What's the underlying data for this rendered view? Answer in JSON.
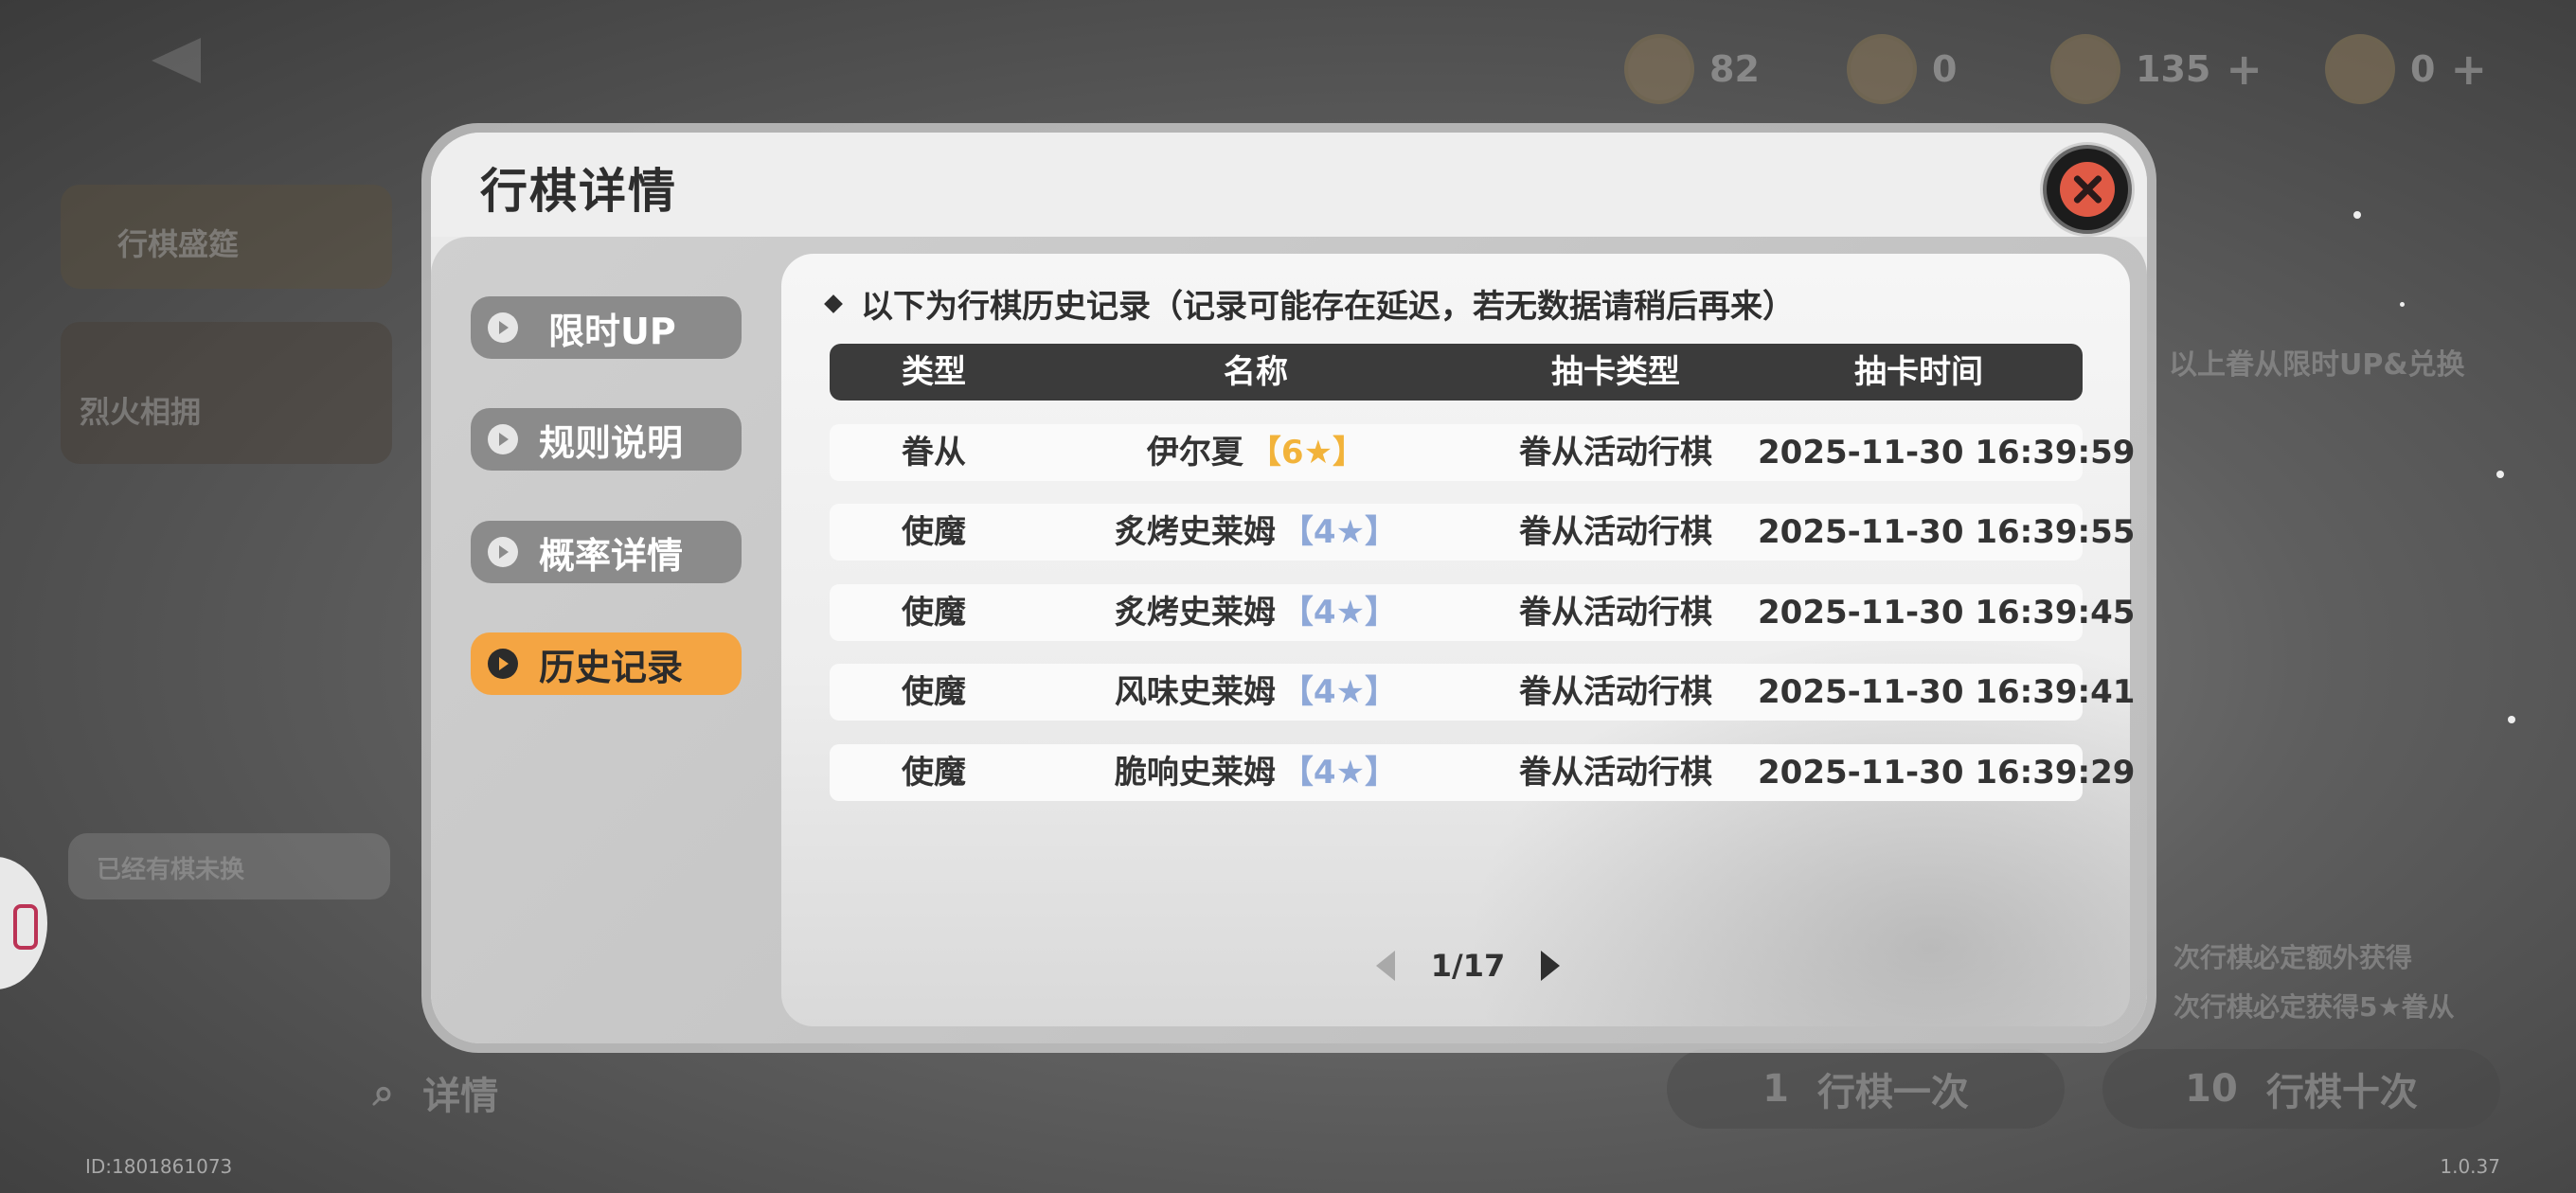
{
  "background": {
    "resources": [
      {
        "icon": "coin-icon",
        "value": "82",
        "has_plus": false
      },
      {
        "icon": "character-token-icon",
        "value": "0",
        "has_plus": false
      },
      {
        "icon": "gem-icon",
        "value": "135",
        "has_plus": true
      },
      {
        "icon": "ticket-icon",
        "value": "0",
        "has_plus": true
      }
    ],
    "left_labels": [
      "行棋盛筵",
      "烈火相拥"
    ],
    "left_sub_label": "已经有棋未换",
    "right_label": "以上眷从限时UP&兑换",
    "right_hint_1": "次行棋必定额外获得",
    "right_hint_2": "次行棋必定获得5★眷从",
    "detail_label": "详情",
    "draw_one": {
      "count": "1",
      "label": "行棋一次"
    },
    "draw_ten": {
      "count": "10",
      "label": "行棋十次"
    },
    "plus_symbol": "+",
    "user_id": "ID:1801861073",
    "version": "1.0.37"
  },
  "modal": {
    "title": "行棋详情",
    "tabs": [
      {
        "label": "限时UP",
        "active": false
      },
      {
        "label": "规则说明",
        "active": false
      },
      {
        "label": "概率详情",
        "active": false
      },
      {
        "label": "历史记录",
        "active": true
      }
    ],
    "notice": "以下为行棋历史记录（记录可能存在延迟，若无数据请稍后再来）",
    "table": {
      "headers": {
        "type": "类型",
        "name": "名称",
        "draw_type": "抽卡类型",
        "draw_time": "抽卡时间"
      },
      "rows": [
        {
          "type": "眷从",
          "name": "伊尔夏",
          "rarity": "【6★】",
          "rarity_color": "#f2b33a",
          "draw_type": "眷从活动行棋",
          "draw_time": "2025-11-30 16:39:59"
        },
        {
          "type": "使魔",
          "name": "炙烤史莱姆",
          "rarity": "【4★】",
          "rarity_color": "#8ea8d8",
          "draw_type": "眷从活动行棋",
          "draw_time": "2025-11-30 16:39:55"
        },
        {
          "type": "使魔",
          "name": "炙烤史莱姆",
          "rarity": "【4★】",
          "rarity_color": "#8ea8d8",
          "draw_type": "眷从活动行棋",
          "draw_time": "2025-11-30 16:39:45"
        },
        {
          "type": "使魔",
          "name": "风味史莱姆",
          "rarity": "【4★】",
          "rarity_color": "#8ea8d8",
          "draw_type": "眷从活动行棋",
          "draw_time": "2025-11-30 16:39:41"
        },
        {
          "type": "使魔",
          "name": "脆响史莱姆",
          "rarity": "【4★】",
          "rarity_color": "#8ea8d8",
          "draw_type": "眷从活动行棋",
          "draw_time": "2025-11-30 16:39:29"
        }
      ]
    },
    "pagination": {
      "label": "1/17"
    }
  },
  "colors": {
    "active_tab": "#f4a543",
    "inactive_tab": "#8b8b8b",
    "header_bar": "#3b3b3b",
    "close_button": "#e05a45",
    "six_star": "#f2b33a",
    "four_star": "#8ea8d8"
  }
}
